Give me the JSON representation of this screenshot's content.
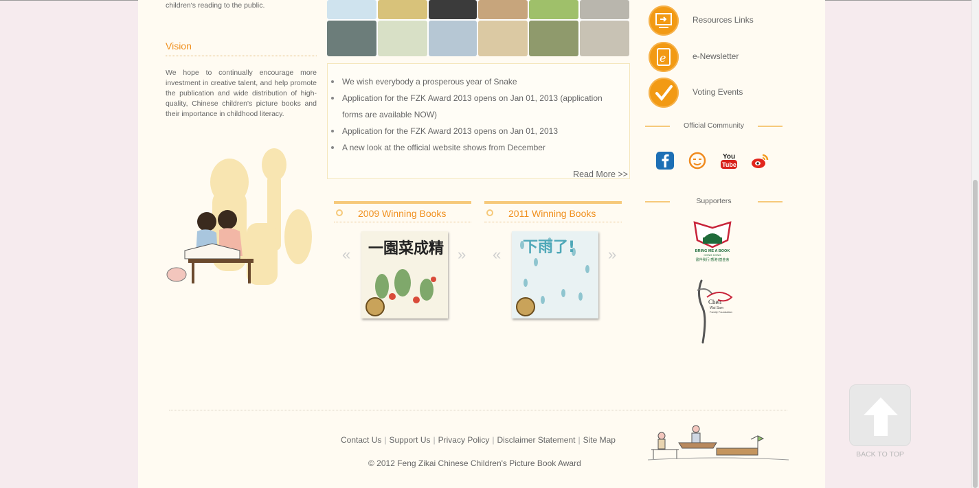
{
  "left": {
    "intro_tail": "children's reading to the public.",
    "vision_title": "Vision",
    "vision_text": "We hope to continually encourage more investment in creative talent, and help promote the publication and wide distribution of high-quality, Chinese children's picture books and their importance in childhood literacy."
  },
  "news": {
    "items": [
      "We wish everybody a prosperous year of Snake",
      "Application for the FZK Award 2013 opens on Jan 01, 2013 (application forms are available NOW)",
      "Application for the FZK Award 2013 opens on Jan 01, 2013",
      "A new look at the official website shows from December"
    ],
    "read_more": "Read More >>"
  },
  "winning": {
    "w2009": "2009 Winning Books",
    "w2011": "2011 Winning Books",
    "prev": "«",
    "next": "»",
    "book2009_title": "一園菜成精",
    "book2011_title": "下雨了!"
  },
  "resources": {
    "links": "Resources Links",
    "newsletter": "e-Newsletter",
    "voting": "Voting Events"
  },
  "community": {
    "title": "Official Community",
    "youtube_you": "You",
    "youtube_tube": "Tube"
  },
  "supporters": {
    "title": "Supporters",
    "bring_me_a_book": "BRING ME A BOOK",
    "bring_me_a_book_sub": "HONG KONG",
    "bring_me_a_book_cn": "書伴我行(香港)基金會",
    "foundation_name": "Chen",
    "foundation_sub": "Wai Sam",
    "foundation_sub2": "Family Foundation"
  },
  "footer": {
    "links": [
      "Contact Us",
      "Support Us",
      "Privacy Policy",
      "Disclaimer Statement",
      "Site Map"
    ],
    "copyright": "© 2012 Feng Zikai Chinese Children's Picture Book Award"
  },
  "back_to_top": "BACK TO TOP",
  "colors": {
    "accent": "#f0901e",
    "accent_light": "#f6c97a",
    "icon_orange": "#f29a14",
    "page_bg": "#fffbf2",
    "outer_bg": "#f6ebee"
  }
}
